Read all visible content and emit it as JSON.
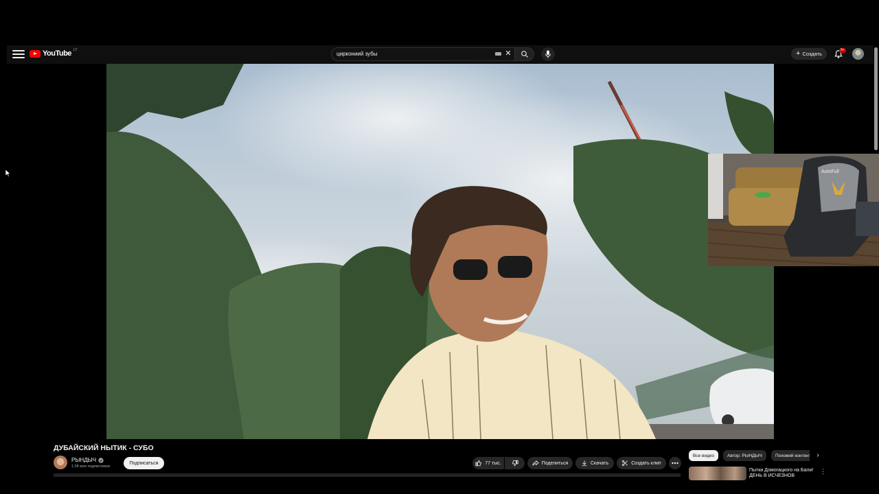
{
  "header": {
    "logo_text": "YouTube",
    "logo_country": "LT",
    "search_value": "циркониий зубы",
    "create_label": "Создать",
    "notifications_badge": "9+"
  },
  "video": {
    "title": "ДУБАЙСКИЙ НЫТИК - СУБО",
    "channel_name": "РЫНДЫЧ",
    "channel_subs": "1,58 млн подписчиков",
    "subscribe_label": "Подписаться",
    "likes": "77 тыс.",
    "share_label": "Поделиться",
    "download_label": "Скачать",
    "clip_label": "Создать клип"
  },
  "sidebar_right": {
    "chips": [
      "Все видео",
      "Автор: РЫНДЫЧ",
      "Похожий контент"
    ],
    "recommendation": {
      "title": "Пытки Домогацкого на Бали! ДЕНЬ В ИСЧЕЗНОВ"
    }
  },
  "webcam_overlay": {
    "chair_brand": "AutoFull"
  },
  "icons": {
    "menu": "menu-icon",
    "search": "search-icon",
    "mic": "mic-icon",
    "bell": "bell-icon",
    "like": "thumbs-up-icon",
    "dislike": "thumbs-down-icon",
    "share": "share-icon",
    "download": "download-icon",
    "clip": "scissors-icon"
  },
  "colors": {
    "brand_red": "#ff0000",
    "background": "#0f0f0f",
    "pill": "#272727"
  }
}
